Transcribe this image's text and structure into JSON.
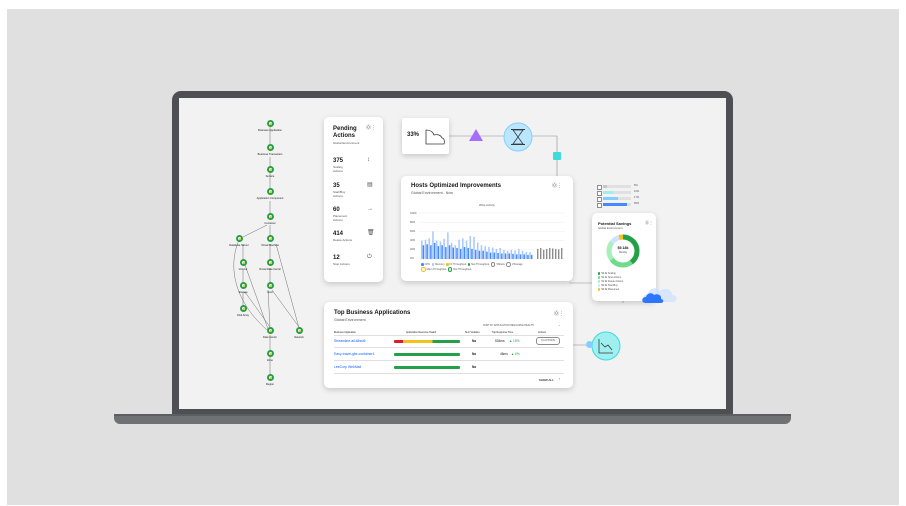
{
  "topology": {
    "nodes": [
      {
        "label": "Business Application"
      },
      {
        "label": "Business Transaction"
      },
      {
        "label": "Service"
      },
      {
        "label": "Application Component"
      },
      {
        "label": "Container"
      },
      {
        "label": "Database Server"
      },
      {
        "label": "Virtual Machine"
      },
      {
        "label": "Volume"
      },
      {
        "label": "Virtual Data Center"
      },
      {
        "label": "Storage"
      },
      {
        "label": "Host"
      },
      {
        "label": "Disk Array"
      },
      {
        "label": "Data Center"
      },
      {
        "label": "Network"
      },
      {
        "label": "Zone"
      },
      {
        "label": "Region"
      }
    ]
  },
  "pending": {
    "title": "Pending Actions",
    "subtitle": "Global Environment",
    "items": [
      {
        "count": "375",
        "label": "Scaling Actions",
        "icon": "scale-icon"
      },
      {
        "count": "35",
        "label": "Start/Buy Actions",
        "icon": "document-icon"
      },
      {
        "count": "60",
        "label": "Placement Actions",
        "icon": "arrow-right-icon"
      },
      {
        "count": "414",
        "label": "Delete Actions",
        "icon": "trash-icon"
      },
      {
        "count": "12",
        "label": "Stop Actions",
        "icon": "power-icon"
      }
    ]
  },
  "flow": {
    "percent": "33%"
  },
  "hosts_chart": {
    "title": "Hosts Optimized Improvements",
    "subtitle": "Global Environment - Now",
    "inner_title": "Write Activity",
    "y_ticks": [
      "100%",
      "80%",
      "60%",
      "40%",
      "20%",
      "0%"
    ],
    "legend": [
      "CPU",
      "Memory",
      "IO Throughput",
      "Net Throughput",
      "VMsize",
      "VStorage",
      "Mem Throughput",
      "Net Throughput"
    ]
  },
  "chart_data": {
    "type": "bar",
    "title": "Hosts Optimized Improvements",
    "ylim": [
      0,
      100
    ],
    "series": [
      {
        "name": "CPU",
        "values": [
          40,
          42,
          45,
          60,
          40,
          38,
          44,
          58,
          35,
          30,
          42,
          45,
          40,
          50,
          48,
          36,
          30,
          28,
          26,
          25,
          22,
          24,
          20,
          18,
          20,
          19,
          22,
          18,
          16,
          15
        ]
      },
      {
        "name": "Memory",
        "values": [
          30,
          32,
          30,
          35,
          28,
          30,
          26,
          30,
          25,
          24,
          22,
          26,
          24,
          22,
          20,
          18,
          18,
          16,
          14,
          14,
          13,
          12,
          12,
          12,
          11,
          10,
          10,
          10,
          9,
          9
        ]
      }
    ],
    "gray_values": [
      22,
      24,
      20,
      22,
      24,
      23,
      22,
      21,
      24
    ]
  },
  "savings": {
    "title": "Potential Savings",
    "subtitle": "Global Environment",
    "center_value": "$9.18k",
    "center_label": "Monthly",
    "legend": [
      {
        "label": "Scaling",
        "value": "$3.6k",
        "color": "#24a148"
      },
      {
        "label": "Spot Actions",
        "value": "$2.2k",
        "color": "#6fdc8c"
      },
      {
        "label": "Delete Actions",
        "value": "$1.9k",
        "color": "#a7f0ba"
      },
      {
        "label": "Start/Buy",
        "value": "$0.9k",
        "color": "#d0e2ff"
      },
      {
        "label": "Placement",
        "value": "$0.5k",
        "color": "#f1c21b"
      }
    ],
    "mini_bars": [
      {
        "label": "8%",
        "fill": 0.15,
        "color": "#c6c6c6"
      },
      {
        "label": "10%",
        "fill": 0.35,
        "color": "#9ef0f0"
      },
      {
        "label": "17%",
        "fill": 0.55,
        "color": "#82cfff"
      },
      {
        "label": "65%",
        "fill": 0.85,
        "color": "#4589ff"
      }
    ]
  },
  "apps": {
    "title": "Top Business Applications",
    "subtitle": "Global Environment",
    "sort_label": "SORT BY APPLICATION RESOURCE HEALTH",
    "columns": [
      "Business Application",
      "Application Resource Health",
      "SLO Violation",
      "Top Response Time",
      "Actions"
    ],
    "rows": [
      {
        "name": "Streamline-all-k8ssl6",
        "slo": "No",
        "response": "534ms",
        "trend": "▲ 15%",
        "action": "16 ACTIONS"
      },
      {
        "name": "Easy-travel-gke-container1",
        "slo": "No",
        "response": "46ms",
        "trend": "▲ 6%",
        "action": ""
      },
      {
        "name": "LeeCorp WebMail",
        "slo": "No",
        "response": "",
        "trend": "",
        "action": ""
      }
    ],
    "show_all": "SHOW ALL"
  }
}
